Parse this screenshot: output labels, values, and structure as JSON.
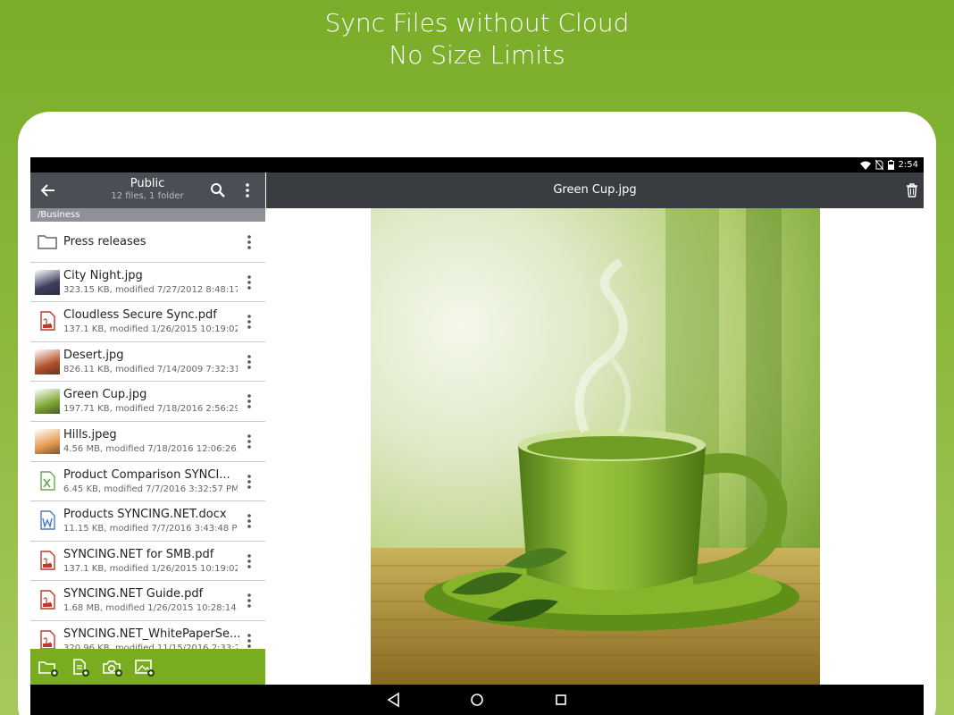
{
  "promo": {
    "line1": "Sync Files without Cloud",
    "line2": "No Size Limits"
  },
  "status_bar": {
    "time": "2:54",
    "icons": [
      "wifi-icon",
      "no-sim-icon",
      "battery-icon"
    ]
  },
  "left_pane": {
    "title": "Public",
    "subtitle": "12 files, 1 folder",
    "breadcrumb": "/Business",
    "files": [
      {
        "name": "Press releases",
        "meta": "",
        "icon": "folder-icon",
        "type": "folder"
      },
      {
        "name": "City Night.jpg",
        "meta": "323.15 KB, modified 7/27/2012 8:48:17...",
        "icon": "image-thumbnail",
        "type": "image",
        "thumb_color": "#3b3f5e"
      },
      {
        "name": "Cloudless Secure Sync.pdf",
        "meta": "137.1 KB, modified 1/26/2015 10:19:02...",
        "icon": "pdf-icon",
        "type": "pdf"
      },
      {
        "name": "Desert.jpg",
        "meta": "826.11 KB, modified 7/14/2009 7:32:31...",
        "icon": "image-thumbnail",
        "type": "image",
        "thumb_color": "#b4502a"
      },
      {
        "name": "Green Cup.jpg",
        "meta": "197.71 KB, modified 7/18/2016 2:56:29...",
        "icon": "image-thumbnail",
        "type": "image",
        "thumb_color": "#7ea632"
      },
      {
        "name": "Hills.jpeg",
        "meta": "4.56 MB, modified 7/18/2016 12:06:26...",
        "icon": "image-thumbnail",
        "type": "image",
        "thumb_color": "#e59a4e"
      },
      {
        "name": "Product Comparison SYNCI...",
        "meta": "6.45 KB, modified 7/7/2016 3:32:57 PM",
        "icon": "excel-icon",
        "type": "xlsx"
      },
      {
        "name": "Products SYNCING.NET.docx",
        "meta": "11.15 KB, modified 7/7/2016 3:43:48 PM",
        "icon": "word-icon",
        "type": "docx"
      },
      {
        "name": "SYNCING.NET for SMB.pdf",
        "meta": "137.1 KB, modified 1/26/2015 10:19:02...",
        "icon": "pdf-icon",
        "type": "pdf"
      },
      {
        "name": "SYNCING.NET Guide.pdf",
        "meta": "1.68 MB, modified 1/26/2015 10:28:14...",
        "icon": "pdf-icon",
        "type": "pdf"
      },
      {
        "name": "SYNCING.NET_WhitePaperSe...",
        "meta": "320.96 KB, modified 11/15/2016 2:33:2...",
        "icon": "pdf-icon",
        "type": "pdf"
      }
    ],
    "bottom_actions": [
      "new-folder-icon",
      "new-file-icon",
      "camera-icon",
      "add-image-icon"
    ]
  },
  "right_pane": {
    "title": "Green Cup.jpg"
  },
  "colors": {
    "brand_green": "#7aac1f",
    "header_dark": "#393d42",
    "left_header": "#4a4f55",
    "pdf_red": "#c0392b",
    "excel_green": "#6aa84f",
    "word_blue": "#4a7fc1"
  },
  "nav_bar": [
    "back-nav-icon",
    "home-nav-icon",
    "recents-nav-icon"
  ]
}
